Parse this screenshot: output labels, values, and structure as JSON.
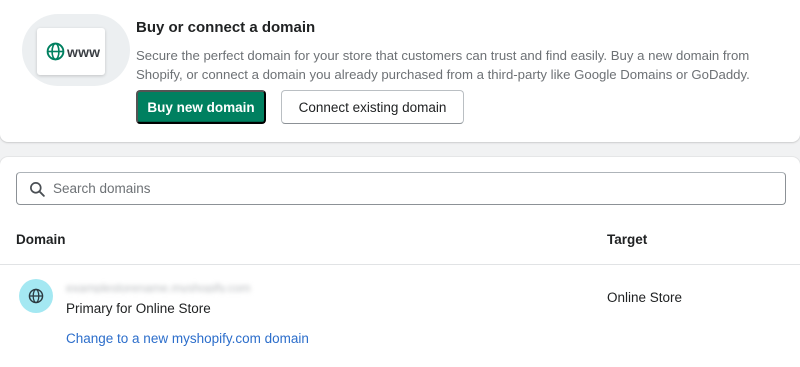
{
  "promo": {
    "illustration_text": "www",
    "illustration_icon": "globe-icon",
    "title": "Buy or connect a domain",
    "description": "Secure the perfect domain for your store that customers can trust and find easily. Buy a new domain from Shopify, or connect a domain you already purchased from a third-party like Google Domains or GoDaddy.",
    "buy_button": "Buy new domain",
    "connect_button": "Connect existing domain"
  },
  "search": {
    "icon": "search-icon",
    "placeholder": "Search domains",
    "value": ""
  },
  "table": {
    "headers": {
      "domain": "Domain",
      "target": "Target"
    },
    "rows": [
      {
        "icon": "globe-icon",
        "domain": "examplestorename.myshopify.com",
        "subtitle": "Primary for Online Store",
        "target": "Online Store",
        "action_link": "Change to a new myshopify.com domain"
      }
    ]
  },
  "colors": {
    "primary": "#008060",
    "link": "#2c6ecb",
    "avatar_bg": "#a4e8f2"
  }
}
